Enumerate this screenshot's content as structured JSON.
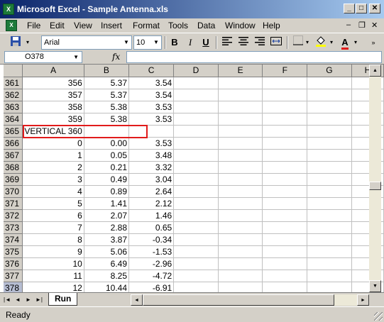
{
  "window": {
    "title": "Microsoft Excel - Sample Antenna.xls",
    "controls": [
      "_",
      "□",
      "✕"
    ]
  },
  "menu": {
    "items": [
      "File",
      "Edit",
      "View",
      "Insert",
      "Format",
      "Tools",
      "Data",
      "Window",
      "Help"
    ],
    "mdi_controls": [
      "–",
      "❐",
      "✕"
    ]
  },
  "toolbar": {
    "font_name": "Arial",
    "font_size": "10",
    "bold": "B",
    "italic": "I",
    "underline": "U",
    "font_color_glyph": "A"
  },
  "formula_bar": {
    "name_box": "O378",
    "fx_label": "fx",
    "content": ""
  },
  "sheet": {
    "columns": [
      "A",
      "B",
      "C",
      "D",
      "E",
      "F",
      "G",
      "H"
    ],
    "rows": [
      {
        "n": "361",
        "a": "356",
        "b": "5.37",
        "c": "3.54"
      },
      {
        "n": "362",
        "a": "357",
        "b": "5.37",
        "c": "3.54"
      },
      {
        "n": "363",
        "a": "358",
        "b": "5.38",
        "c": "3.53"
      },
      {
        "n": "364",
        "a": "359",
        "b": "5.38",
        "c": "3.53"
      },
      {
        "n": "365",
        "a": "VERTICAL 360",
        "b": "",
        "c": ""
      },
      {
        "n": "366",
        "a": "0",
        "b": "0.00",
        "c": "3.53"
      },
      {
        "n": "367",
        "a": "1",
        "b": "0.05",
        "c": "3.48"
      },
      {
        "n": "368",
        "a": "2",
        "b": "0.21",
        "c": "3.32"
      },
      {
        "n": "369",
        "a": "3",
        "b": "0.49",
        "c": "3.04"
      },
      {
        "n": "370",
        "a": "4",
        "b": "0.89",
        "c": "2.64"
      },
      {
        "n": "371",
        "a": "5",
        "b": "1.41",
        "c": "2.12"
      },
      {
        "n": "372",
        "a": "6",
        "b": "2.07",
        "c": "1.46"
      },
      {
        "n": "373",
        "a": "7",
        "b": "2.88",
        "c": "0.65"
      },
      {
        "n": "374",
        "a": "8",
        "b": "3.87",
        "c": "-0.34"
      },
      {
        "n": "375",
        "a": "9",
        "b": "5.06",
        "c": "-1.53"
      },
      {
        "n": "376",
        "a": "10",
        "b": "6.49",
        "c": "-2.96"
      },
      {
        "n": "377",
        "a": "11",
        "b": "8.25",
        "c": "-4.72"
      },
      {
        "n": "378",
        "a": "12",
        "b": "10.44",
        "c": "-6.91"
      }
    ],
    "active_row": "378",
    "highlight_color": "#e11b1b"
  },
  "tabs": {
    "sheets": [
      "Run"
    ],
    "nav": [
      "|◄",
      "◄",
      "►",
      "►|"
    ]
  },
  "status": {
    "text": "Ready"
  }
}
